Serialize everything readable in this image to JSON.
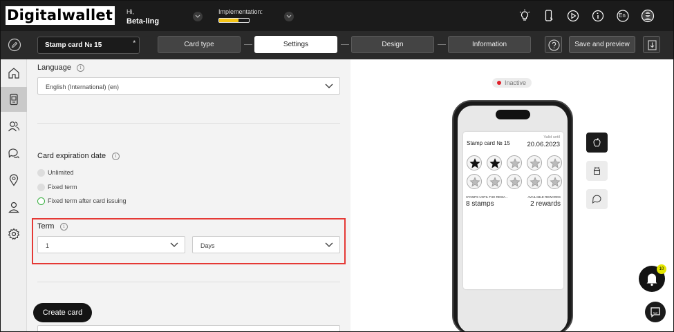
{
  "header": {
    "logo": "Digitalwallet",
    "greeting": "Hi,",
    "user": "Beta-ling",
    "implementation_label": "Implementation:",
    "implementation_progress_percent": 65,
    "language_badge": "En"
  },
  "navbar": {
    "card_name": "Stamp card № 15",
    "card_name_marker": "*",
    "steps": [
      {
        "label": "Card type",
        "active": false
      },
      {
        "label": "Settings",
        "active": true
      },
      {
        "label": "Design",
        "active": false
      },
      {
        "label": "Information",
        "active": false
      }
    ],
    "save_label": "Save and preview"
  },
  "sidebar": {
    "items": [
      {
        "icon": "home-icon",
        "active": false
      },
      {
        "icon": "card-device-icon",
        "active": true
      },
      {
        "icon": "users-icon",
        "active": false
      },
      {
        "icon": "chat-icon",
        "active": false
      },
      {
        "icon": "location-icon",
        "active": false
      },
      {
        "icon": "user-icon",
        "active": false
      },
      {
        "icon": "gear-icon",
        "active": false
      }
    ]
  },
  "settings": {
    "language_label": "Language",
    "language_value": "English (International) (en)",
    "expiration_label": "Card expiration date",
    "expiration_options": [
      {
        "label": "Unlimited",
        "selected": false
      },
      {
        "label": "Fixed term",
        "selected": false
      },
      {
        "label": "Fixed term after card issuing",
        "selected": true
      }
    ],
    "term_label": "Term",
    "term_value": "1",
    "term_unit": "Days",
    "create_label": "Create card"
  },
  "preview": {
    "status": "Inactive",
    "status_color": "#e0202a",
    "card_title": "Stamp card № 15",
    "valid_until_label": "Valid until",
    "valid_until": "20.06.2023",
    "stamps_total": 10,
    "stamps_collected": 2,
    "stamps_until_label": "STAMPS UNTIL THE REWA...",
    "stamps_until_value": "8 stamps",
    "rewards_label": "AVAILABLE REWARDS",
    "rewards_value": "2 rewards",
    "platforms": [
      "apple-icon",
      "android-icon",
      "message-icon"
    ],
    "notification_count": "10"
  }
}
